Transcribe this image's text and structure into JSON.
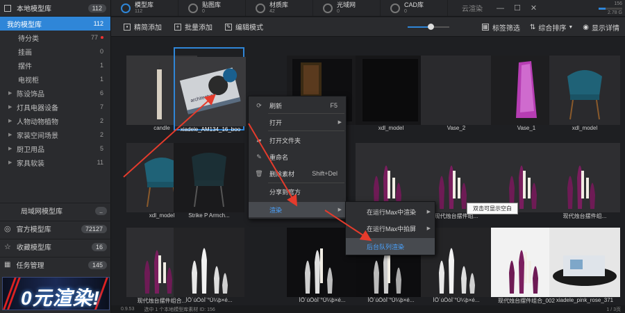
{
  "sidebar": {
    "header": {
      "label": "本地模型库",
      "count": "112"
    },
    "items": [
      {
        "label": "我的模型库",
        "count": "112",
        "active": true,
        "kind": "flat"
      },
      {
        "label": "待分类",
        "count": "77",
        "kind": "sub",
        "dot": true
      },
      {
        "label": "挂画",
        "count": "0",
        "kind": "sub"
      },
      {
        "label": "摆件",
        "count": "1",
        "kind": "sub"
      },
      {
        "label": "电视柜",
        "count": "1",
        "kind": "sub"
      },
      {
        "label": "陈设饰品",
        "count": "6",
        "kind": "tree"
      },
      {
        "label": "灯具电器设备",
        "count": "7",
        "kind": "tree"
      },
      {
        "label": "人物动物植物",
        "count": "2",
        "kind": "tree"
      },
      {
        "label": "家装空间场景",
        "count": "2",
        "kind": "tree"
      },
      {
        "label": "厨卫用品",
        "count": "5",
        "kind": "tree"
      },
      {
        "label": "家具软装",
        "count": "11",
        "kind": "tree"
      }
    ],
    "lan": {
      "label": "局域网模型库",
      "count": ".."
    },
    "official": {
      "label": "官方模型库",
      "count": "72127"
    },
    "favorites": {
      "label": "收藏模型库",
      "count": "16"
    },
    "tasks": {
      "label": "任务管理",
      "count": "145"
    },
    "banner_text": "0元渲染!"
  },
  "tabs": [
    {
      "name": "模型库",
      "count": "112",
      "active": true
    },
    {
      "name": "贴图库",
      "count": "0"
    },
    {
      "name": "材质库",
      "count": "42"
    },
    {
      "name": "光域网",
      "count": "0"
    },
    {
      "name": "CAD库",
      "count": "0"
    }
  ],
  "top": {
    "cloud": "云渲染",
    "storage_top": "156",
    "storage_bottom": "2.78 G",
    "storage_fill": 0.3
  },
  "toolbar": {
    "quick_add": "精简添加",
    "batch_add": "批量添加",
    "edit_mode": "编辑模式",
    "slider_value": 0.55,
    "tag_filter": "标签筛选",
    "sort": "综合排序",
    "details": "显示详情"
  },
  "cards": [
    {
      "caption": "candle",
      "thumb": "candle"
    },
    {
      "caption": "xiadele_AM134_16_boo",
      "thumb": "book",
      "selected": true
    },
    {
      "caption": "",
      "thumb": "dark"
    },
    {
      "caption": "xdl_model",
      "thumb": "darkvase"
    },
    {
      "caption": "Vase_2",
      "thumb": "plain"
    },
    {
      "caption": "Vase_1",
      "thumb": "pinkvase"
    },
    {
      "caption": "xdl_model",
      "thumb": "chair"
    },
    {
      "caption": "xdl_model",
      "thumb": "chair"
    },
    {
      "caption": "Strike P Armch...",
      "thumb": "chairdark"
    },
    {
      "caption": "",
      "thumb": "hidden"
    },
    {
      "caption": "",
      "thumb": "candles"
    },
    {
      "caption": "现代烛台摆件组...",
      "thumb": "candles"
    },
    {
      "caption": "",
      "thumb": "candles"
    },
    {
      "caption": "现代烛台摆件组...",
      "thumb": "candles"
    },
    {
      "caption": "现代烛台摆件组合...",
      "thumb": "candles"
    },
    {
      "caption": "ÌÕ´úÓòÌ¨°Ú¼þ×é...",
      "thumb": "white"
    },
    {
      "caption": "ÌÕ´úÓòÌ¨°Ú¼þ×é...",
      "thumb": "whitedark"
    },
    {
      "caption": "ÌÕ´úÓòÌ¨°Ú¼þ×é...",
      "thumb": "candlesdark"
    },
    {
      "caption": "ÌÕ´úÓòÌ¨°Ú¼þ×é...",
      "thumb": "white"
    },
    {
      "caption": "现代烛台摆件组合_002",
      "thumb": "candleslight"
    },
    {
      "caption": "xiadele_pink_rose_371",
      "thumb": "table"
    }
  ],
  "context_menu": [
    {
      "label": "刷新",
      "shortcut": "F5",
      "icon": "refresh-icon",
      "glyph": "⟳"
    },
    {
      "label": "打开",
      "arrow": true
    },
    {
      "label": "打开文件夹",
      "icon": "folder-icon",
      "glyph": "▰"
    },
    {
      "label": "重命名",
      "icon": "rename-icon",
      "glyph": "✎"
    },
    {
      "label": "删除素材",
      "shortcut": "Shift+Del",
      "icon": "trash-icon",
      "glyph": "🗑"
    },
    {
      "label": "分享到官方"
    },
    {
      "label": "渲染",
      "arrow": true,
      "highlight": true
    }
  ],
  "submenu": [
    {
      "label": "在运行Max中渲染",
      "arrow": true
    },
    {
      "label": "在运行Max中拍屏",
      "arrow": true
    },
    {
      "label": "后台队列渲染",
      "highlight": true
    }
  ],
  "tooltip": "双击可显示空白",
  "status": {
    "version": "0.9.53",
    "selection": "选中 1 个本地模型库素材 ID: 156",
    "page": "1 / 3页"
  }
}
